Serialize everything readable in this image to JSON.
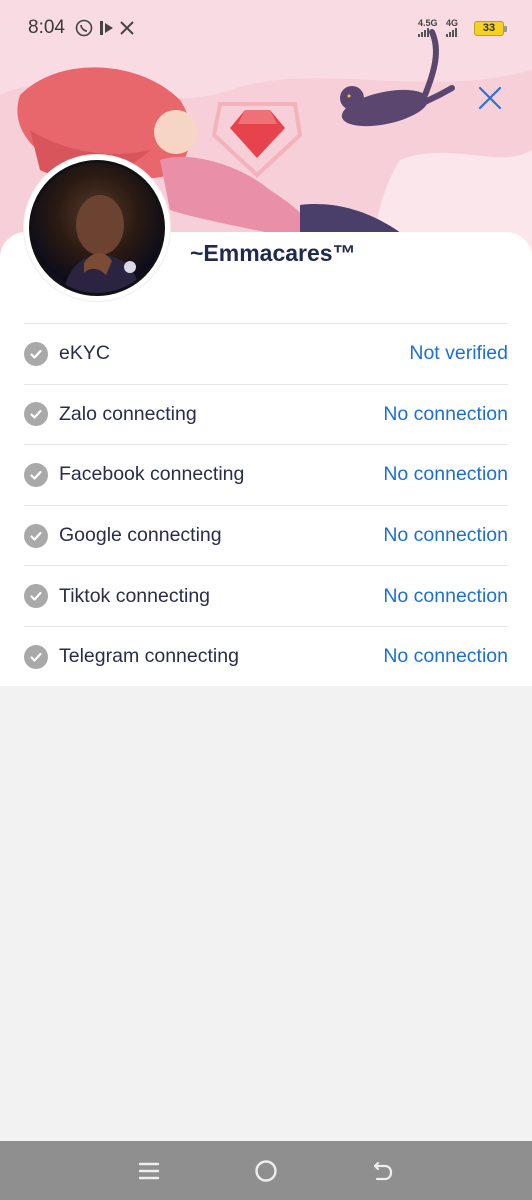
{
  "status_bar": {
    "time": "8:04",
    "network_1": "4.5G",
    "network_2": "4G",
    "battery": "33",
    "icons": [
      "whatsapp-icon",
      "media-play-icon",
      "x-icon"
    ]
  },
  "profile": {
    "username": "~Emmacares™"
  },
  "colors": {
    "header_bg": "#f9dbe4",
    "accent_blue": "#1d6fd8",
    "check_gray": "#a9a9a9",
    "title_navy": "#1f2a4d",
    "navbar_bg": "#8f8f8f"
  },
  "connections": [
    {
      "label": "eKYC",
      "status": "Not verified"
    },
    {
      "label": "Zalo connecting",
      "status": "No connection"
    },
    {
      "label": "Facebook connecting",
      "status": "No connection"
    },
    {
      "label": "Google connecting",
      "status": "No connection"
    },
    {
      "label": "Tiktok connecting",
      "status": "No connection"
    },
    {
      "label": "Telegram connecting",
      "status": "No connection"
    }
  ],
  "navbar": {
    "icons": [
      "menu-icon",
      "home-circle-icon",
      "back-icon"
    ]
  }
}
